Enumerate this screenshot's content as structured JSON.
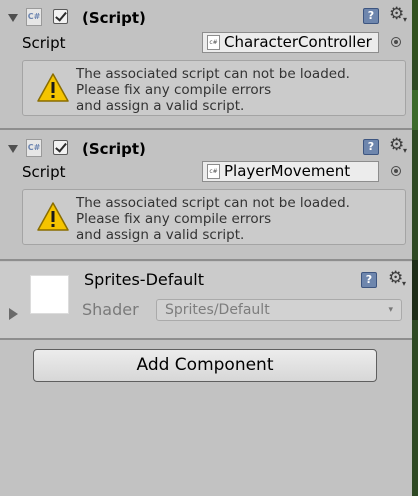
{
  "components": [
    {
      "title": "(Script)",
      "field_label": "Script",
      "field_value": "CharacterController",
      "warning": [
        "The associated script can not be loaded.",
        "Please fix any compile errors",
        "and assign a valid script."
      ]
    },
    {
      "title": "(Script)",
      "field_label": "Script",
      "field_value": "PlayerMovement",
      "warning": [
        "The associated script can not be loaded.",
        "Please fix any compile errors",
        "and assign a valid script."
      ]
    }
  ],
  "material": {
    "name": "Sprites-Default",
    "shader_label": "Shader",
    "shader_value": "Sprites/Default"
  },
  "add_component_label": "Add Component",
  "icons": {
    "script_icon": "C#",
    "file_icon": "c#",
    "help": "?",
    "gear": "⚙",
    "caret": "▾"
  },
  "colors": {
    "panel_bg": "#c2c2c2",
    "help_icon": "#6e86ad",
    "warning_yellow": "#f5c400"
  }
}
